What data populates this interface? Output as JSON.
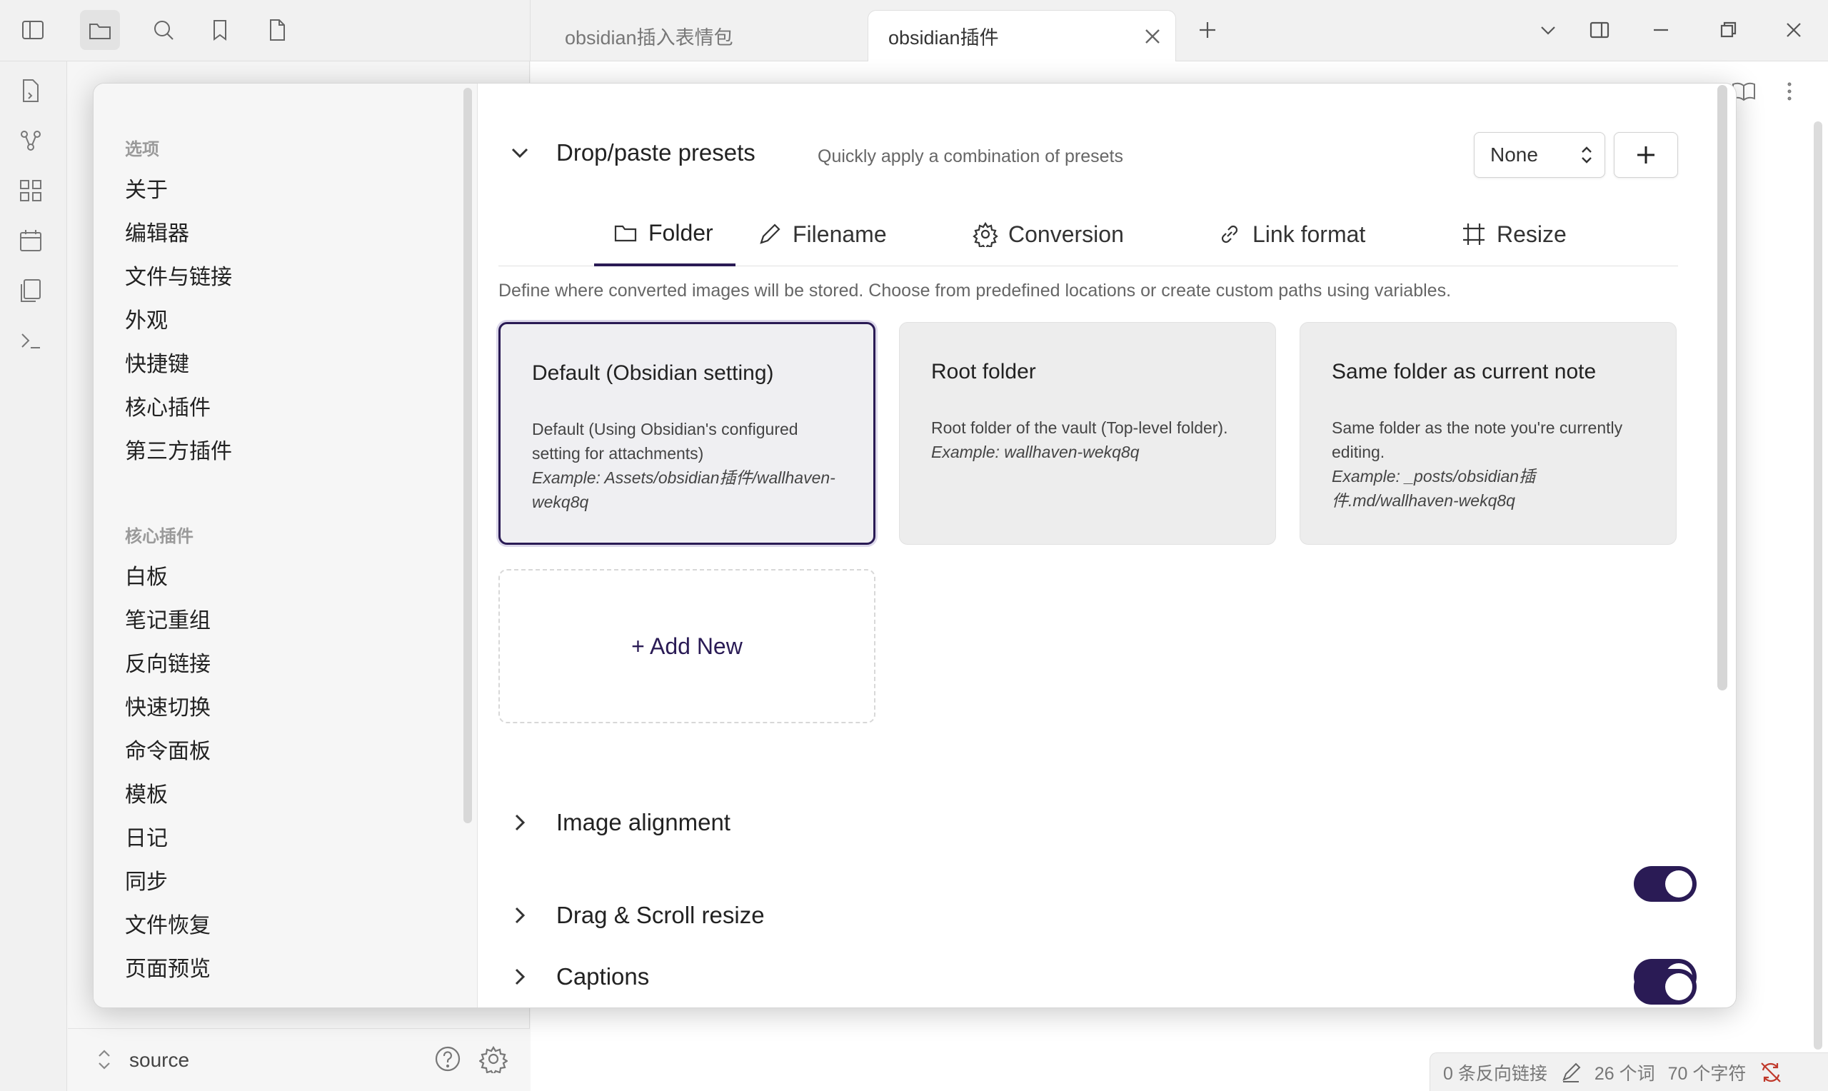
{
  "tabs": [
    {
      "label": "obsidian插入表情包",
      "active": false
    },
    {
      "label": "obsidian插件",
      "active": true
    }
  ],
  "settings": {
    "sidebar": {
      "heading_options": "选项",
      "options": [
        "关于",
        "编辑器",
        "文件与链接",
        "外观",
        "快捷键",
        "核心插件",
        "第三方插件"
      ],
      "heading_core": "核心插件",
      "core_plugins": [
        "白板",
        "笔记重组",
        "反向链接",
        "快速切换",
        "命令面板",
        "模板",
        "日记",
        "同步",
        "文件恢复",
        "页面预览"
      ]
    },
    "presets": {
      "title": "Drop/paste presets",
      "description": "Quickly apply a combination of presets",
      "select_value": "None"
    },
    "subtabs": [
      {
        "label": "Folder",
        "icon": "folder-icon",
        "active": true
      },
      {
        "label": "Filename",
        "icon": "pencil-icon",
        "active": false
      },
      {
        "label": "Conversion",
        "icon": "gear-icon",
        "active": false
      },
      {
        "label": "Link format",
        "icon": "link-icon",
        "active": false
      },
      {
        "label": "Resize",
        "icon": "crop-icon",
        "active": false
      }
    ],
    "folder_intro": "Define where converted images will be stored. Choose from predefined locations or create custom paths using variables.",
    "cards": [
      {
        "title": "Default (Obsidian setting)",
        "desc": "Default (Using Obsidian's configured setting for attachments)",
        "example": "Example: Assets/obsidian插件/wallhaven-wekq8q",
        "selected": true
      },
      {
        "title": "Root folder",
        "desc": "Root folder of the vault (Top-level folder).",
        "example": "Example: wallhaven-wekq8q",
        "selected": false
      },
      {
        "title": "Same folder as current note",
        "desc": "Same folder as the note you're currently editing.",
        "example": "Example: _posts/obsidian插件.md/wallhaven-wekq8q",
        "selected": false
      }
    ],
    "add_new": "+ Add New",
    "sections": [
      {
        "title": "Image alignment",
        "enabled": true
      },
      {
        "title": "Drag & Scroll resize",
        "enabled": true
      },
      {
        "title": "Captions",
        "enabled": true
      }
    ]
  },
  "vault": {
    "name": "source"
  },
  "status": {
    "backlinks": "0 条反向链接",
    "words": "26 个词",
    "chars": "70 个字符"
  },
  "colors": {
    "accent": "#2a1b55"
  }
}
